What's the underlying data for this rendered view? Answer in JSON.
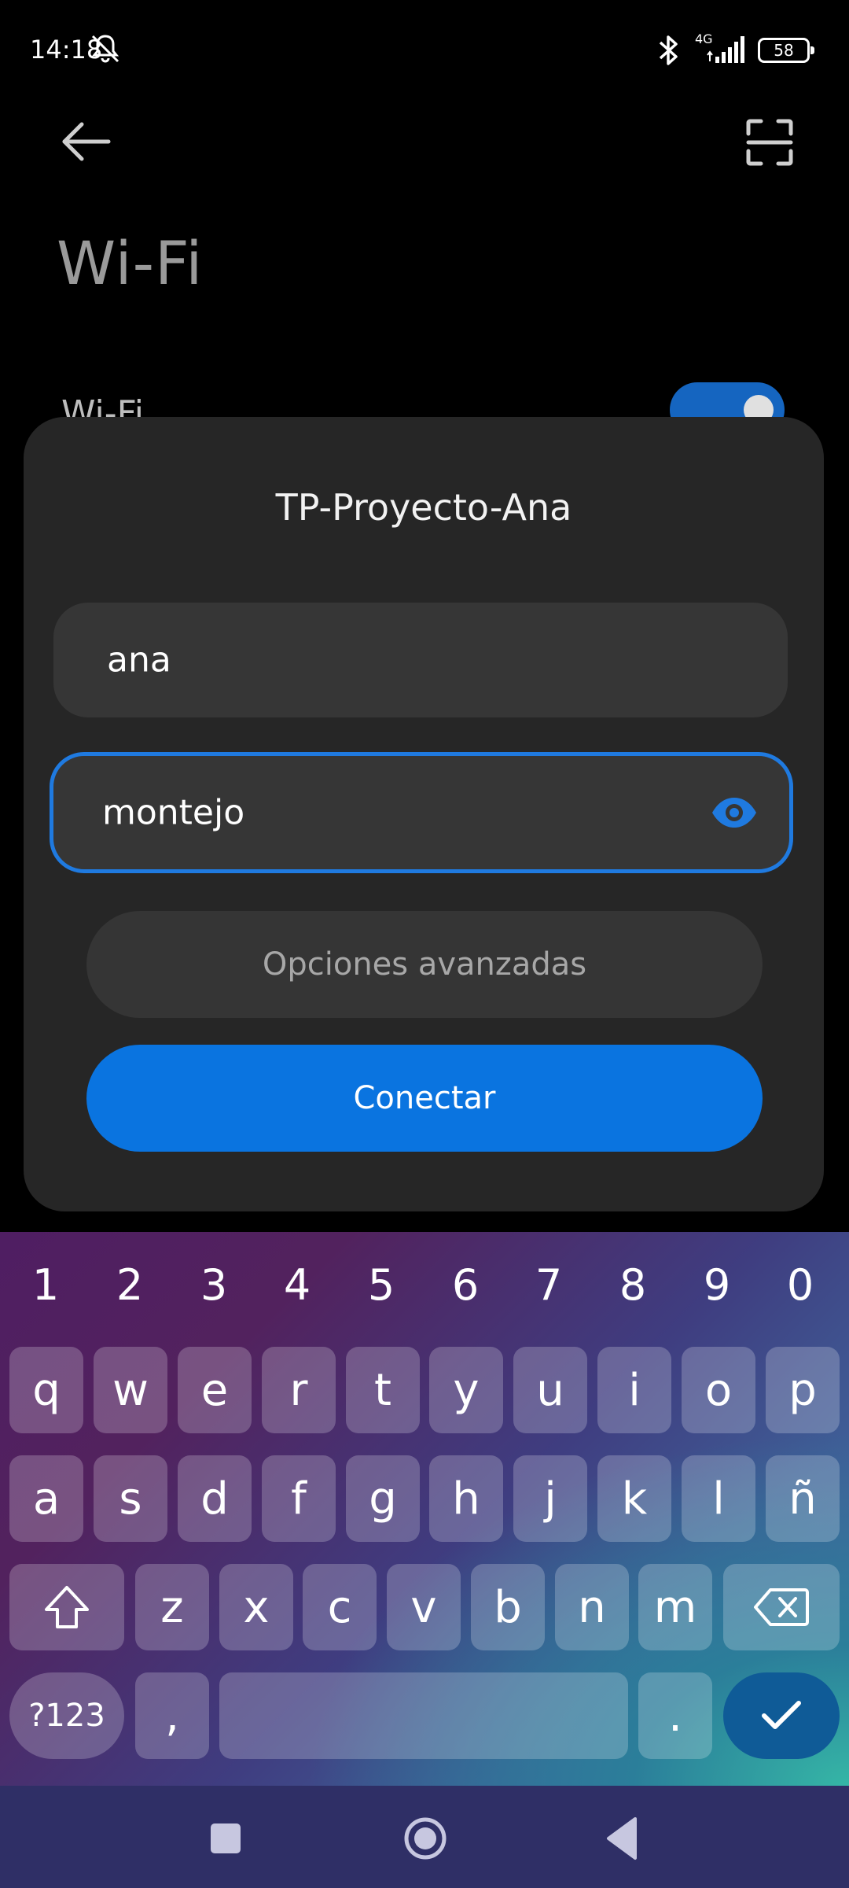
{
  "status_bar": {
    "time": "14:18",
    "network": "4G",
    "battery": "58",
    "icons": [
      "mute-icon",
      "bluetooth-icon",
      "signal-icon",
      "battery-icon"
    ]
  },
  "header": {
    "title": "Wi-Fi",
    "back_icon": "back-arrow-icon",
    "scan_icon": "qr-scan-icon"
  },
  "wifi_row": {
    "label": "Wi-Fi",
    "enabled": true
  },
  "dialog": {
    "title": "TP-Proyecto-Ana",
    "username_value": "ana",
    "password_value": "montejo",
    "password_visible": true,
    "advanced_label": "Opciones avanzadas",
    "connect_label": "Conectar"
  },
  "keyboard": {
    "numbers": [
      "1",
      "2",
      "3",
      "4",
      "5",
      "6",
      "7",
      "8",
      "9",
      "0"
    ],
    "row1": [
      "q",
      "w",
      "e",
      "r",
      "t",
      "y",
      "u",
      "i",
      "o",
      "p"
    ],
    "row2": [
      "a",
      "s",
      "d",
      "f",
      "g",
      "h",
      "j",
      "k",
      "l",
      "ñ"
    ],
    "row3": [
      "z",
      "x",
      "c",
      "v",
      "b",
      "n",
      "m"
    ],
    "symbols_label": "?123",
    "comma": ",",
    "period": "."
  },
  "colors": {
    "accent": "#0a74e0",
    "dialog_bg": "#262626",
    "field_bg": "#363636",
    "nav_bg": "#2f2f66"
  }
}
